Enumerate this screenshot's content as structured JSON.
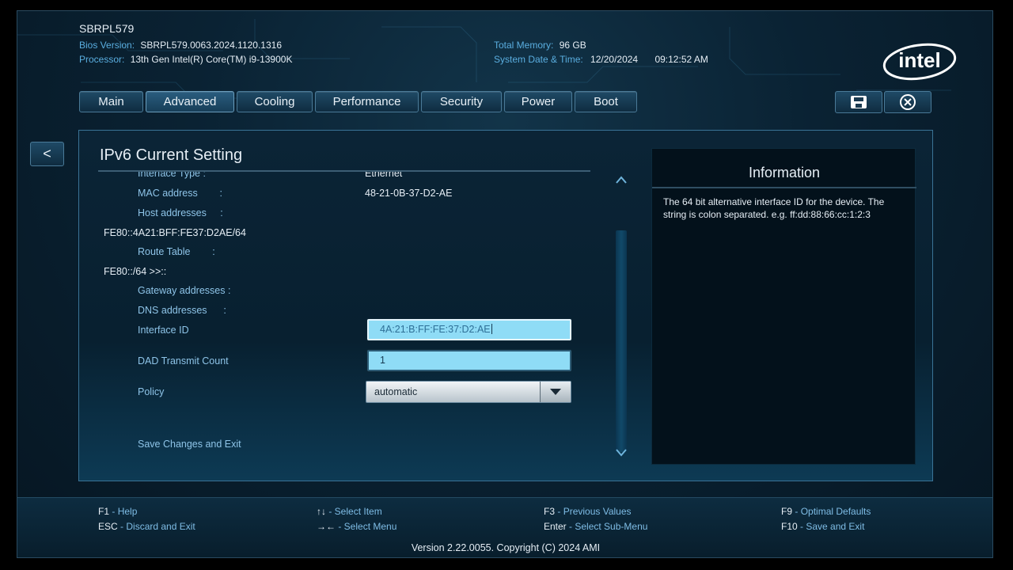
{
  "header": {
    "hostname": "SBRPL579",
    "bios_version_label": "Bios Version:",
    "bios_version": "SBRPL579.0063.2024.1120.1316",
    "processor_label": "Processor:",
    "processor": "13th Gen Intel(R) Core(TM) i9-13900K",
    "total_memory_label": "Total Memory:",
    "total_memory": "96 GB",
    "datetime_label": "System Date & Time:",
    "date": "12/20/2024",
    "time": "09:12:52 AM",
    "logo_text": "intel"
  },
  "tabs": [
    {
      "label": "Main"
    },
    {
      "label": "Advanced"
    },
    {
      "label": "Cooling"
    },
    {
      "label": "Performance"
    },
    {
      "label": "Security"
    },
    {
      "label": "Power"
    },
    {
      "label": "Boot"
    }
  ],
  "active_tab": "Advanced",
  "icons": {
    "save": "save-icon",
    "exit": "close-circle-icon",
    "back": "back-arrow"
  },
  "back_label": "<",
  "panel": {
    "title": "IPv6 Current Setting",
    "rows": {
      "interface_type_label": "Interface Type     :",
      "interface_type_value": "Ethernet",
      "mac_label": "MAC address        :",
      "mac_value": "48-21-0B-37-D2-AE",
      "host_label": "Host addresses     :",
      "host_value": "FE80::4A21:BFF:FE37:D2AE/64",
      "route_label": "Route Table        :",
      "route_value": "FE80::/64 >>::",
      "gateway_label": "Gateway addresses :",
      "dns_label": "DNS addresses      :",
      "interface_id_label": "Interface ID",
      "interface_id_value": "4A:21:B:FF:FE:37:D2:AE",
      "dad_label": "DAD Transmit Count",
      "dad_value": "1",
      "policy_label": "Policy",
      "policy_value": "automatic",
      "save_exit_label": "Save Changes and Exit"
    }
  },
  "info": {
    "title": "Information",
    "body": "The 64 bit alternative interface ID for the device. The string is colon separated. e.g. ff:dd:88:66:cc:1:2:3"
  },
  "footer": {
    "f1_key": "F1",
    "f1_desc": "Help",
    "esc_key": "ESC",
    "esc_desc": "Discard and Exit",
    "updown_key": "↑↓",
    "updown_desc": "Select Item",
    "leftright_key": "→←",
    "leftright_desc": "Select Menu",
    "f3_key": "F3",
    "f3_desc": "Previous Values",
    "enter_key": "Enter",
    "enter_desc": "Select Sub-Menu",
    "f9_key": "F9",
    "f9_desc": "Optimal Defaults",
    "f10_key": "F10",
    "f10_desc": "Save and Exit",
    "version": "Version 2.22.0055. Copyright (C) 2024 AMI"
  },
  "colors": {
    "accent": "#5aaee0",
    "field_bg": "#8fdcf6",
    "panel_border": "#3a7396"
  }
}
